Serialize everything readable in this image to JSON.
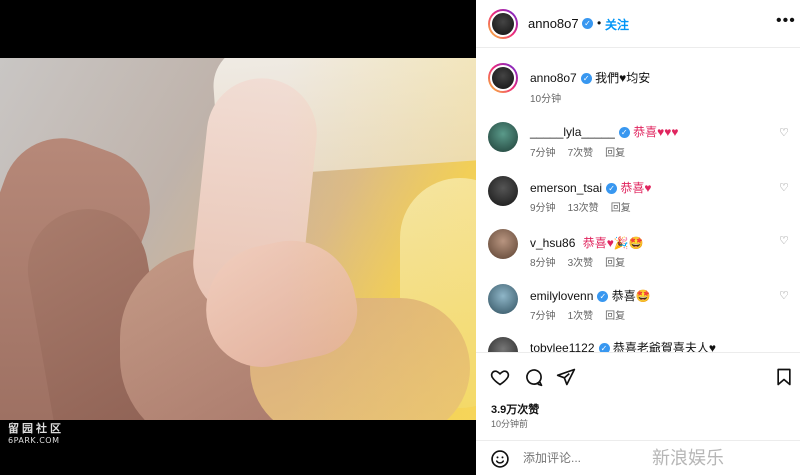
{
  "photo": {
    "watermark_cn": "留园社区",
    "watermark_en": "6PARK.COM"
  },
  "post": {
    "author": "anno8o7",
    "follow_label": "关注",
    "dot": "•",
    "caption": "我們♥均安",
    "caption_time": "10分钟"
  },
  "comments": [
    {
      "user": "_____lyla_____",
      "text": "恭喜♥♥♥",
      "time": "7分钟",
      "likes": "7次赞",
      "reply": "回复"
    },
    {
      "user": "emerson_tsai",
      "text": "恭喜♥",
      "time": "9分钟",
      "likes": "13次赞",
      "reply": "回复"
    },
    {
      "user": "v_hsu86",
      "text": "恭喜♥🎉🤩",
      "time": "8分钟",
      "likes": "3次赞",
      "reply": "回复"
    },
    {
      "user": "emilylovenn",
      "text": "恭喜🤩",
      "time": "7分钟",
      "likes": "1次赞",
      "reply": "回复"
    },
    {
      "user": "tobylee1122",
      "text": "恭喜老爺賀喜夫人♥",
      "time": "",
      "likes": "",
      "reply": ""
    }
  ],
  "stats": {
    "likes": "3.9万次赞",
    "posted": "10分钟前"
  },
  "add_comment": {
    "placeholder": "添加评论..."
  },
  "icons": [
    "more-icon",
    "heart-icon",
    "comment-icon",
    "share-icon",
    "save-icon",
    "emoji-icon",
    "verified-icon"
  ],
  "colors": {
    "accent": "#0095f6",
    "verified": "#3897f0",
    "heart": "#e0245e"
  },
  "site_watermark": "新浪娱乐"
}
